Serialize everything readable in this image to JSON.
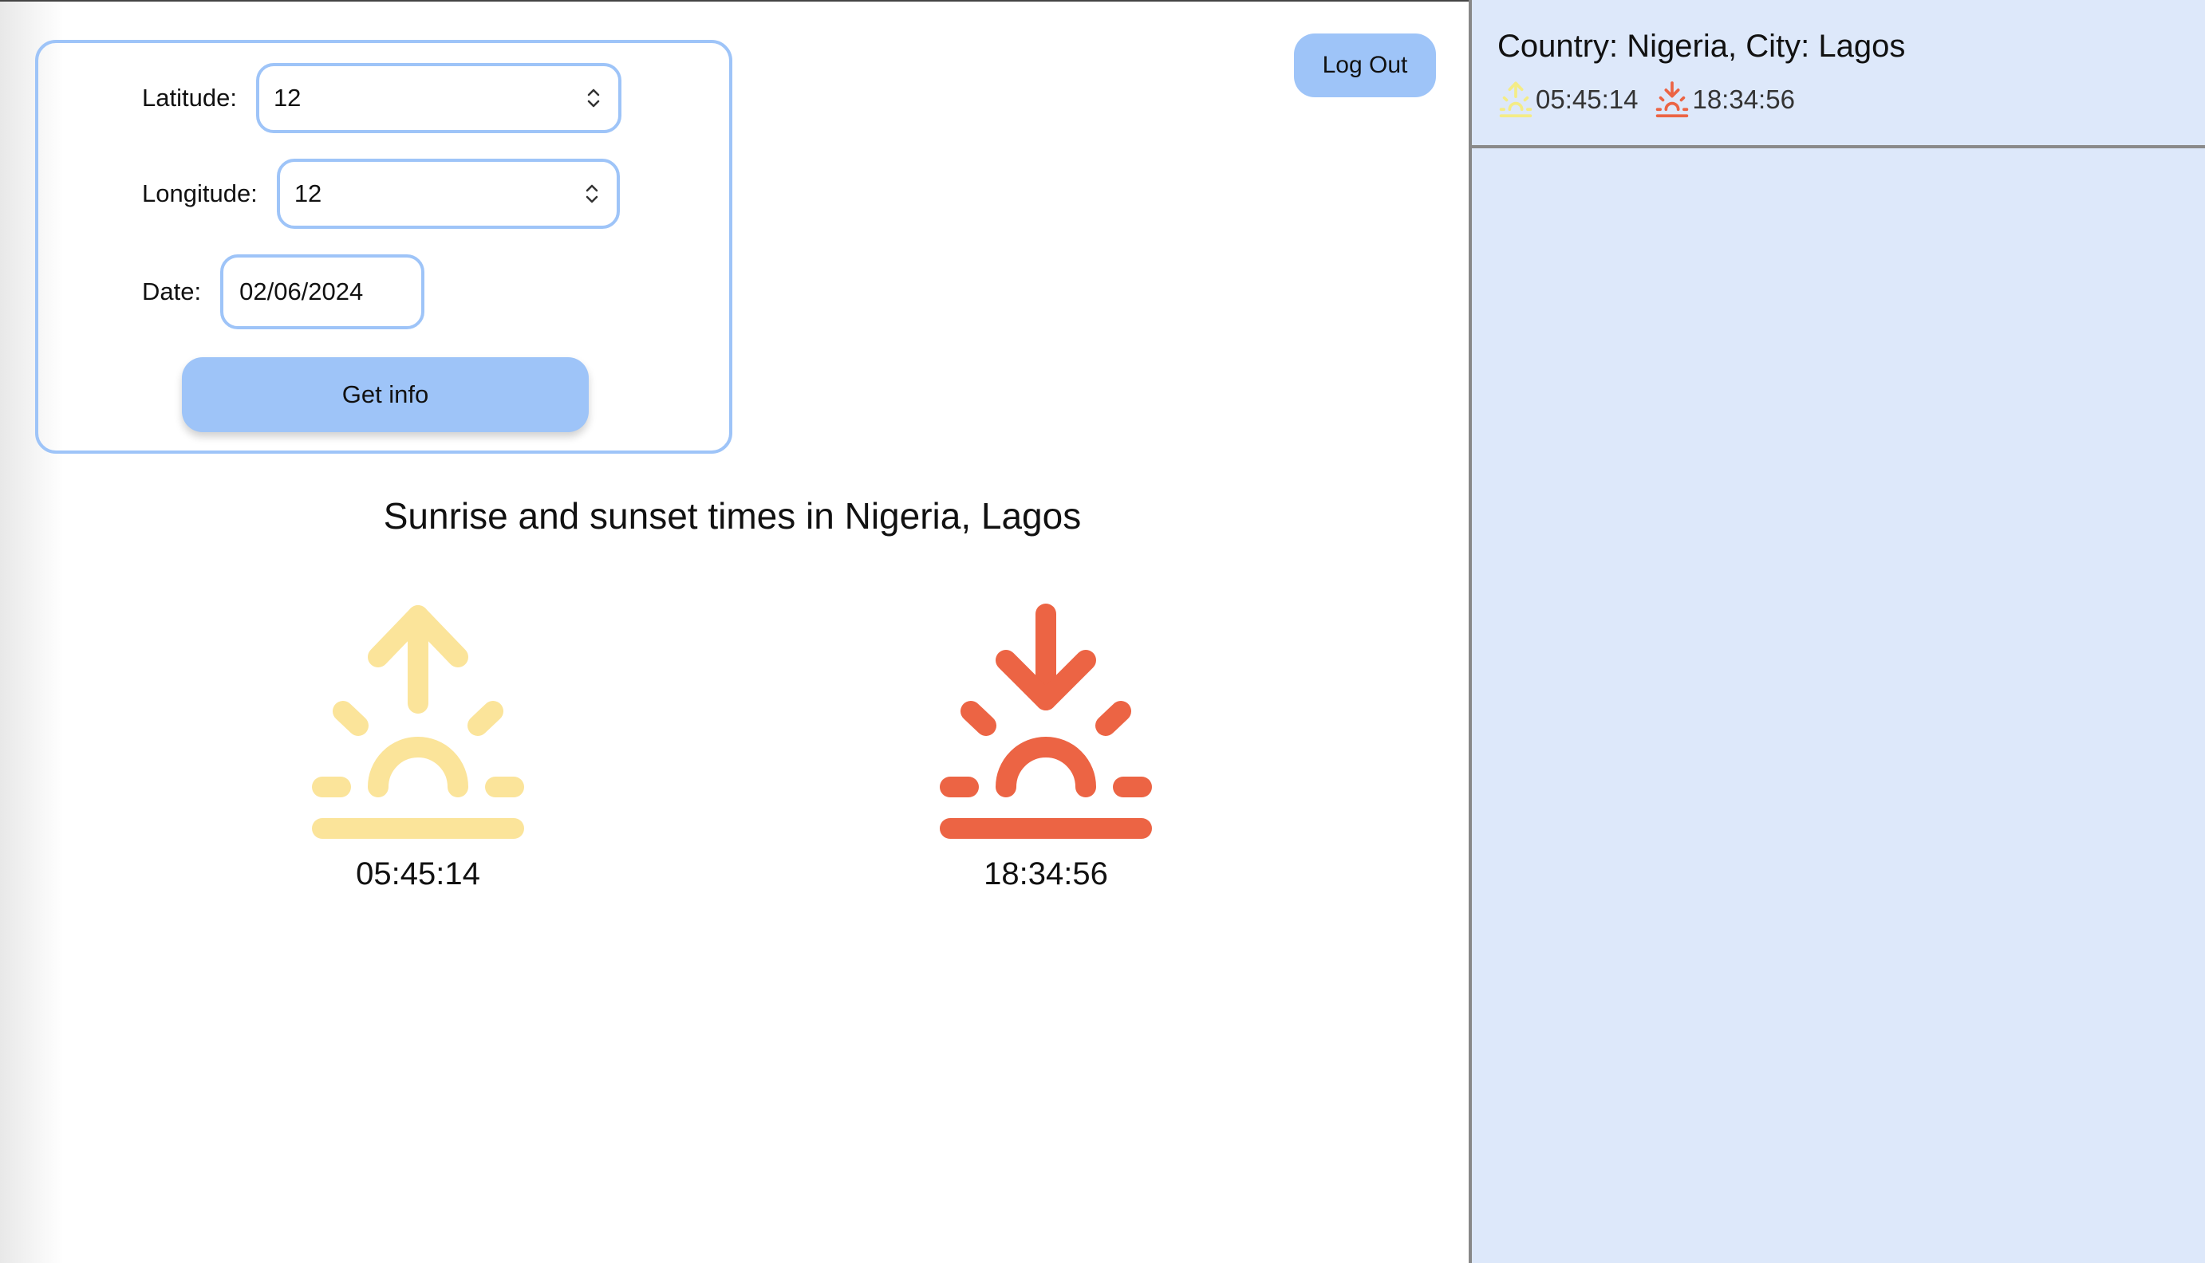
{
  "form": {
    "latitude_label": "Latitude:",
    "latitude_value": "12",
    "longitude_label": "Longitude:",
    "longitude_value": "12",
    "date_label": "Date:",
    "date_value": "02/06/2024",
    "submit_label": "Get info"
  },
  "header": {
    "logout_label": "Log Out"
  },
  "results": {
    "title": "Sunrise and sunset times in Nigeria, Lagos",
    "sunrise_time": "05:45:14",
    "sunset_time": "18:34:56",
    "sunrise_icon": "sunrise-icon",
    "sunset_icon": "sunset-icon"
  },
  "sidebar": {
    "entries": [
      {
        "location": "Country: Nigeria, City: Lagos",
        "sunrise": "05:45:14",
        "sunset": "18:34:56"
      }
    ]
  },
  "colors": {
    "accent": "#9ec4f8",
    "sunrise": "#fbe49a",
    "sunset": "#ec6444",
    "sidebar_bg": "#dde8fa"
  }
}
